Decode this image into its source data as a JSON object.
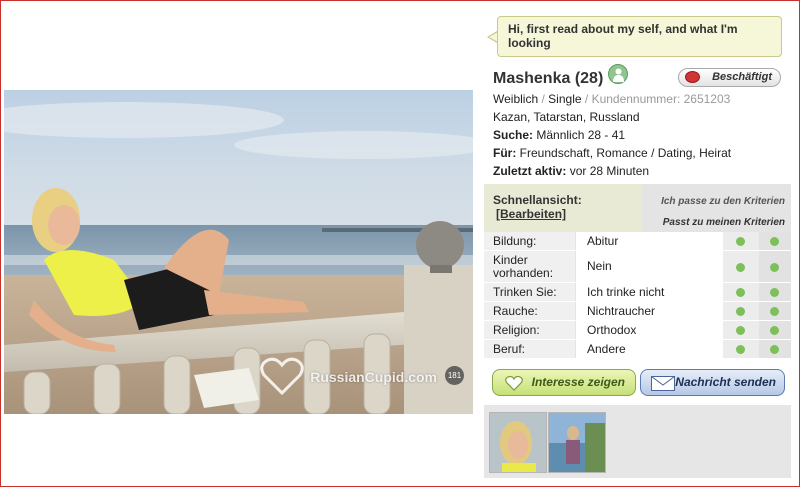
{
  "photo": {
    "watermark": "RussianCupid.com",
    "badge": "181"
  },
  "bubble": {
    "text": "Hi, first read about my self, and what I'm looking"
  },
  "profile": {
    "name": "Mashenka (28)",
    "status_button": "Beschäftigt",
    "gender": "Weiblich",
    "sep": "/",
    "marital": "Single",
    "member_number": "Kundennummer: 2651203",
    "location": "Kazan, Tatarstan, Russland",
    "seeking_label": "Suche:",
    "seeking_value": "Männlich 28 - 41",
    "for_label": "Für:",
    "for_value": "Freundschaft, Romance / Dating, Heirat",
    "last_active_label": "Zuletzt aktiv:",
    "last_active_value": "vor 28 Minuten"
  },
  "quickview": {
    "title": "Schnellansicht:",
    "edit_link": "[Bearbeiten]",
    "col1_header": "Ich passe zu den Kriterien",
    "col2_header": "Passt zu meinen Kriterien",
    "rows": [
      {
        "label": "Bildung:",
        "value": "Abitur"
      },
      {
        "label": "Kinder vorhanden:",
        "value": "Nein"
      },
      {
        "label": "Trinken Sie:",
        "value": "Ich trinke nicht"
      },
      {
        "label": "Rauche:",
        "value": "Nichtraucher"
      },
      {
        "label": "Religion:",
        "value": "Orthodox"
      },
      {
        "label": "Beruf:",
        "value": "Andere"
      }
    ]
  },
  "actions": {
    "interest": "Interesse zeigen",
    "message": "Nachricht senden"
  },
  "icons": {
    "online": "person-online-icon",
    "status": "speech-bubble-icon",
    "interest": "heart-icon",
    "message": "envelope-icon",
    "match": "green-dot-icon"
  },
  "colors": {
    "frame": "#c9302c",
    "match_dot": "#7dbf5a",
    "interest_btn": "#c6e07a",
    "message_btn": "#b5c8e6",
    "bubble_bg": "#f6f6d9"
  }
}
